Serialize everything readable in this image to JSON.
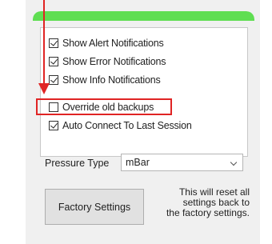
{
  "settings": {
    "header_color": "#5fde52",
    "checkboxes": [
      {
        "label": "Show Alert Notifications",
        "checked": true
      },
      {
        "label": "Show Error Notifications",
        "checked": true
      },
      {
        "label": "Show Info Notifications",
        "checked": true
      },
      {
        "label": "Override old backups",
        "checked": false
      },
      {
        "label": "Auto Connect To Last Session",
        "checked": true
      }
    ],
    "pressure_type_label": "Pressure Type",
    "pressure_type_value": "mBar",
    "factory_button_label": "Factory Settings",
    "factory_note_lines": [
      "This will reset all",
      "settings back to",
      "the factory settings."
    ]
  },
  "annotation": {
    "color": "#e02424",
    "highlighted_item": "Override old backups"
  }
}
